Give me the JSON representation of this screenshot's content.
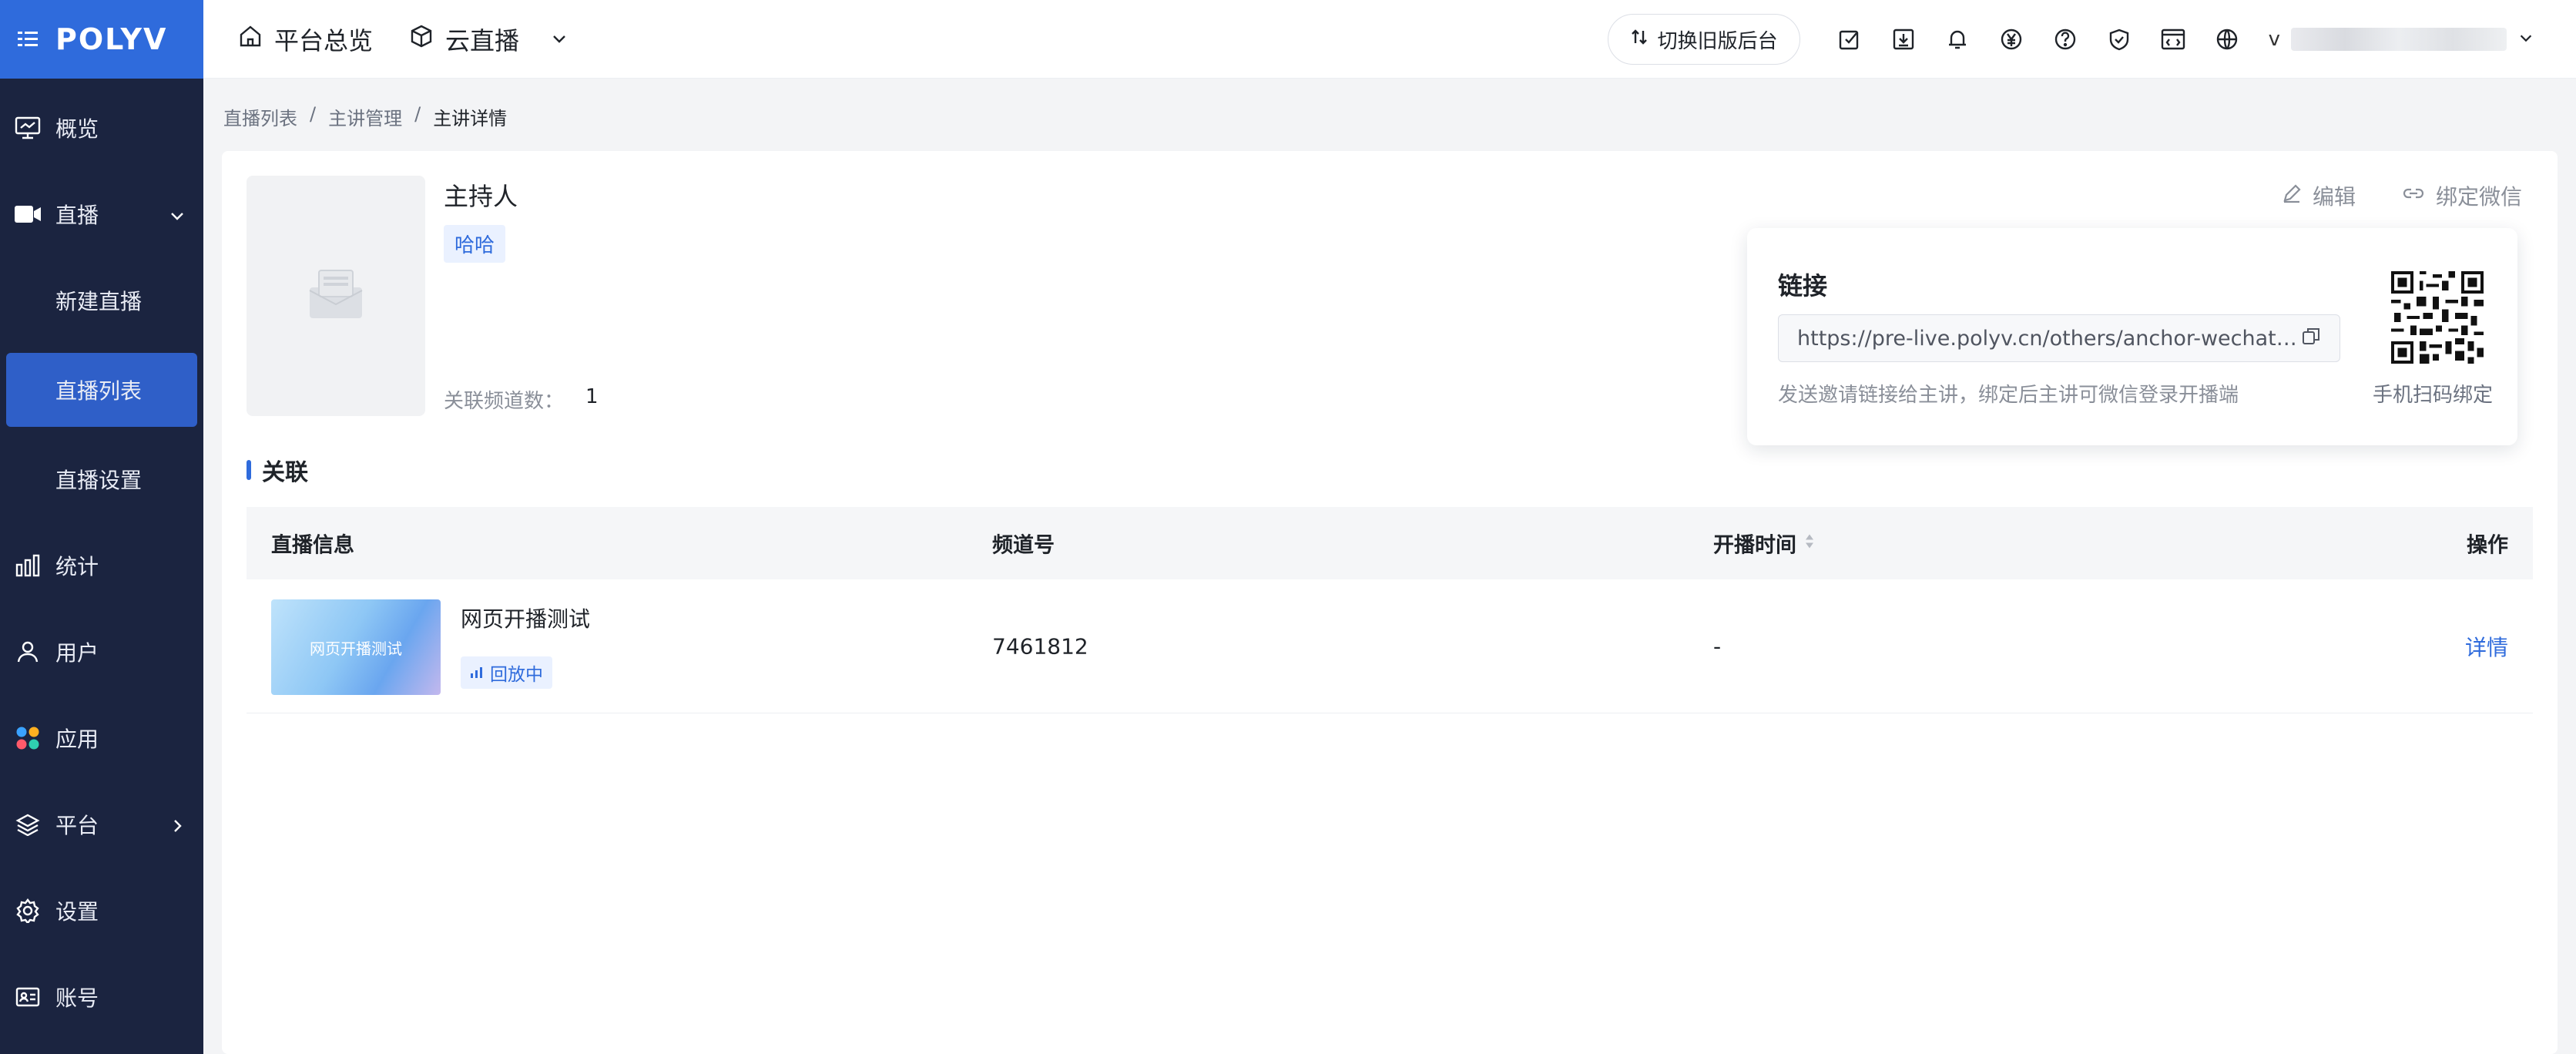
{
  "brand": {
    "name": "POLYV",
    "color": "#2f6bdc"
  },
  "sidebar": {
    "items": [
      {
        "label": "概览",
        "icon": "monitor-icon"
      },
      {
        "label": "直播",
        "icon": "video-camera-icon"
      },
      {
        "label": "统计",
        "icon": "bar-chart-icon"
      },
      {
        "label": "用户",
        "icon": "user-icon"
      },
      {
        "label": "应用",
        "icon": "apps-icon"
      },
      {
        "label": "平台",
        "icon": "layers-icon"
      },
      {
        "label": "设置",
        "icon": "gear-icon"
      },
      {
        "label": "账号",
        "icon": "id-card-icon"
      }
    ],
    "live_sub": [
      {
        "label": "新建直播"
      },
      {
        "label": "直播列表",
        "active": true
      },
      {
        "label": "直播设置"
      }
    ]
  },
  "header": {
    "overview": "平台总览",
    "cloud_live": "云直播",
    "switch_old": "切换旧版后台",
    "user_initial": "v"
  },
  "breadcrumb": [
    "直播列表",
    "主讲管理",
    "主讲详情"
  ],
  "host": {
    "title": "主持人",
    "tag": "哈哈",
    "channel_count_label": "关联频道数：",
    "channel_count": "1",
    "edit": "编辑",
    "bind_wechat": "绑定微信"
  },
  "popup": {
    "title": "链接",
    "link": "https://pre-live.polyv.cn/others/anchor-wechat-...",
    "hint": "发送邀请链接给主讲，绑定后主讲可微信登录开播端",
    "qr_label": "手机扫码绑定"
  },
  "section": {
    "title": "关联"
  },
  "table": {
    "headers": {
      "info": "直播信息",
      "channel": "频道号",
      "time": "开播时间",
      "op": "操作"
    },
    "rows": [
      {
        "thumb_text": "网页开播测试",
        "name": "网页开播测试",
        "status": "回放中",
        "channel": "7461812",
        "time": "-",
        "op": "详情"
      }
    ]
  }
}
